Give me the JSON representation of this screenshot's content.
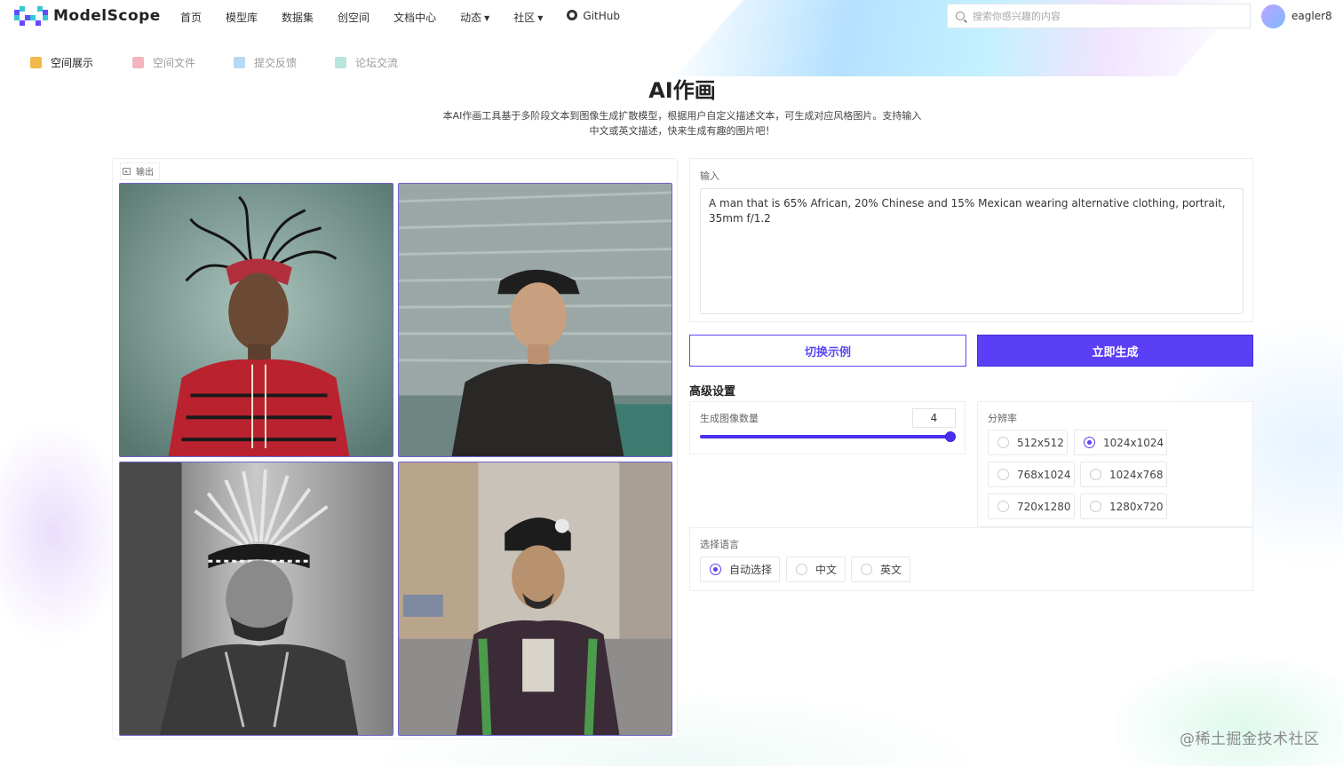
{
  "app": {
    "name": "ModelScope"
  },
  "nav": {
    "items": [
      "首页",
      "模型库",
      "数据集",
      "创空间",
      "文档中心",
      "动态",
      "社区"
    ],
    "github": "GitHub"
  },
  "search": {
    "placeholder": "搜索你感兴趣的内容"
  },
  "user": {
    "name": "eagler8"
  },
  "subnav": {
    "tabs": [
      "空间展示",
      "空间文件",
      "提交反馈",
      "论坛交流"
    ],
    "active": "空间展示"
  },
  "page": {
    "title": "AI作画",
    "description_line1": "本AI作画工具基于多阶段文本到图像生成扩散模型，根据用户自定义描述文本，可生成对应风格图片。支持输入",
    "description_line2": "中文或英文描述，快来生成有趣的图片吧！"
  },
  "output": {
    "label": "输出",
    "images": [
      "portrait-1",
      "portrait-2",
      "portrait-3",
      "portrait-4"
    ]
  },
  "input": {
    "label": "输入",
    "prompt": "A man that is 65% African, 20% Chinese and 15% Mexican wearing alternative clothing, portrait, 35mm f/1.2"
  },
  "buttons": {
    "switch_example": "切换示例",
    "generate": "立即生成"
  },
  "advanced": {
    "title": "高级设置",
    "count_label": "生成图像数量",
    "count_value": "4",
    "count_fraction": 1.0,
    "resolution_label": "分辨率",
    "resolutions": [
      "512x512",
      "1024x1024",
      "768x1024",
      "1024x768",
      "720x1280",
      "1280x720"
    ],
    "resolution_selected": "1024x1024",
    "language_label": "选择语言",
    "languages": [
      "自动选择",
      "中文",
      "英文"
    ],
    "language_selected": "自动选择"
  },
  "watermark": "@稀土掘金技术社区",
  "colors": {
    "accent": "#5b3ff6"
  }
}
